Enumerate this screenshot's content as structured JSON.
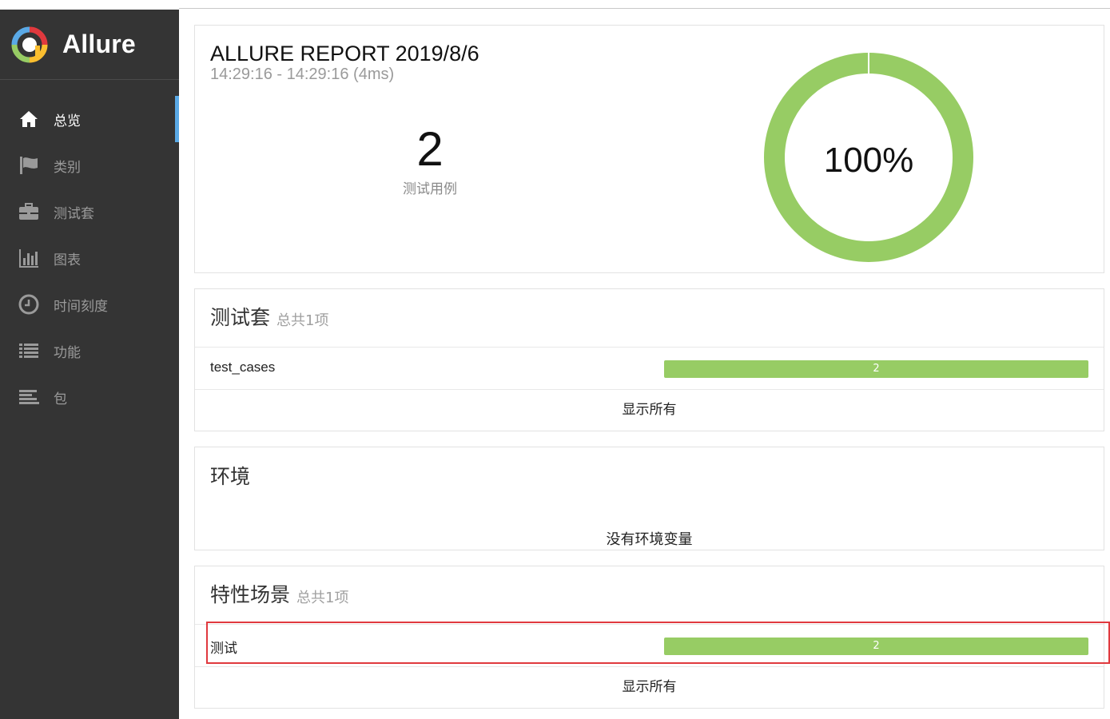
{
  "brand": {
    "name": "Allure"
  },
  "sidebar": {
    "items": [
      {
        "label": "总览",
        "icon": "home-icon",
        "active": true
      },
      {
        "label": "类别",
        "icon": "flag-icon"
      },
      {
        "label": "测试套",
        "icon": "briefcase-icon"
      },
      {
        "label": "图表",
        "icon": "bar-chart-icon"
      },
      {
        "label": "时间刻度",
        "icon": "clock-icon"
      },
      {
        "label": "功能",
        "icon": "list-icon"
      },
      {
        "label": "包",
        "icon": "align-left-icon"
      }
    ]
  },
  "summary": {
    "title": "ALLURE REPORT 2019/8/6",
    "time": "14:29:16 - 14:29:16 (4ms)",
    "test_count": "2",
    "test_count_label": "测试用例",
    "pass_percent": "100%",
    "pass_fraction": 1.0,
    "pass_color": "#97cc64"
  },
  "suites": {
    "title": "测试套",
    "subtitle": "总共1项",
    "rows": [
      {
        "name": "test_cases",
        "count": "2"
      }
    ],
    "show_all": "显示所有"
  },
  "environment": {
    "title": "环境",
    "empty": "没有环境变量"
  },
  "features": {
    "title": "特性场景",
    "subtitle": "总共1项",
    "rows": [
      {
        "name": "测试",
        "count": "2"
      }
    ],
    "show_all": "显示所有"
  },
  "colors": {
    "sidebar_bg": "#343434",
    "active_indicator": "#5aa9e6",
    "bar": "#97cc64",
    "highlight": "#e0393e"
  }
}
